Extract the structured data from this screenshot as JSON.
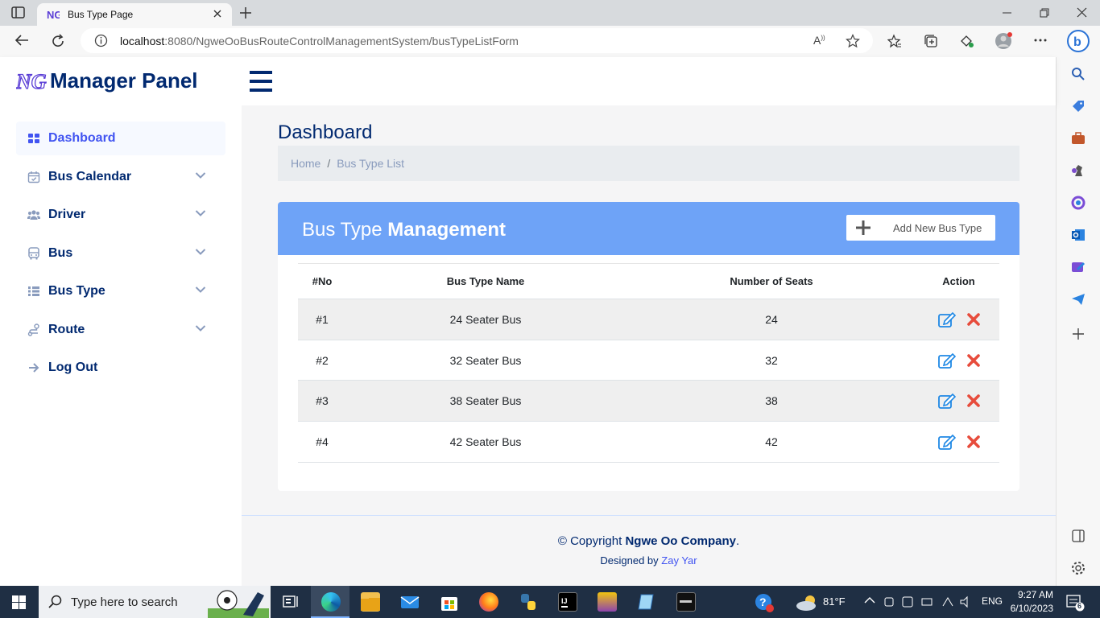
{
  "browser": {
    "tab_title": "Bus Type Page",
    "url_host": "localhost",
    "url_rest": ":8080/NgweOoBusRouteControlManagementSystem/busTypeListForm"
  },
  "app": {
    "brand": "Manager Panel",
    "logo_text": "NG"
  },
  "sidebar": {
    "items": [
      {
        "label": "Dashboard",
        "icon": "grid-icon",
        "active": true
      },
      {
        "label": "Bus Calendar",
        "icon": "calendar-icon",
        "expandable": true
      },
      {
        "label": "Driver",
        "icon": "people-icon",
        "expandable": true
      },
      {
        "label": "Bus",
        "icon": "bus-icon",
        "expandable": true
      },
      {
        "label": "Bus Type",
        "icon": "list-icon",
        "expandable": true
      },
      {
        "label": "Route",
        "icon": "route-icon",
        "expandable": true
      },
      {
        "label": "Log Out",
        "icon": "arrow-right-icon"
      }
    ]
  },
  "page": {
    "title": "Dashboard",
    "breadcrumb": {
      "home": "Home",
      "separator": "/",
      "current": "Bus Type List"
    }
  },
  "card": {
    "title_light": "Bus Type",
    "title_bold": "Management",
    "add_button": "Add New Bus Type",
    "header_color": "#6ea3f7"
  },
  "table": {
    "headers": [
      "#No",
      "Bus Type Name",
      "Number of Seats",
      "Action"
    ],
    "rows": [
      {
        "no": "#1",
        "name": "24 Seater Bus",
        "seats": "24"
      },
      {
        "no": "#2",
        "name": "32 Seater Bus",
        "seats": "32"
      },
      {
        "no": "#3",
        "name": "38 Seater Bus",
        "seats": "38"
      },
      {
        "no": "#4",
        "name": "42 Seater Bus",
        "seats": "42"
      }
    ]
  },
  "footer": {
    "copyright_prefix": "© Copyright",
    "company": "Ngwe Oo Company",
    "period": ".",
    "designed_by": "Designed by",
    "designer": "Zay Yar"
  },
  "taskbar": {
    "search_placeholder": "Type here to search",
    "weather": "81°F",
    "language": "ENG",
    "time": "9:27 AM",
    "date": "6/10/2023",
    "notifications": "6"
  },
  "colors": {
    "navy": "#012970",
    "accent": "#4154f1",
    "edit": "#1e88e5",
    "delete": "#e74c3c"
  }
}
